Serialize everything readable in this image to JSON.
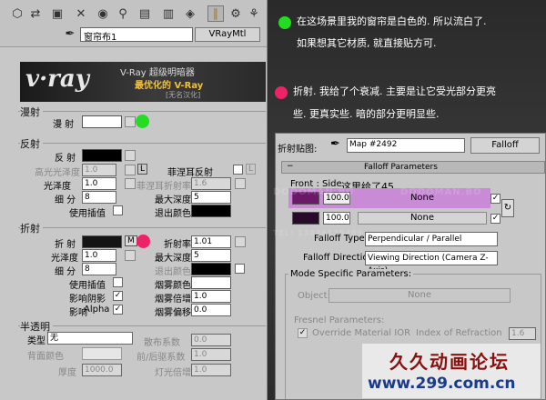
{
  "material_editor": {
    "toolbar_icons": [
      "get-material-icon",
      "put-material-icon",
      "assign-material-icon",
      "reset-icon",
      "make-copy-icon",
      "make-unique-icon",
      "put-library-icon",
      "material-id-icon",
      "show-map-icon",
      "show-end-icon",
      "go-parent-icon",
      "go-sibling-icon"
    ],
    "material_name": "窗帘布1",
    "material_type": "VRayMtl",
    "banner": {
      "logo": "v·ray",
      "line1": "V-Ray 超级明暗器",
      "line2": "最优化的 V-Ray",
      "line3": "[无名汉化]"
    },
    "diffuse": {
      "title": "漫射",
      "label": "漫 射",
      "color": "#ffffff"
    },
    "reflection": {
      "title": "反射",
      "reflect_label": "反 射",
      "reflect_color": "#000000",
      "hilight_gloss_label": "高光光泽度",
      "hilight_gloss_value": "1.0",
      "lock_label": "L",
      "fresnel_label": "菲涅耳反射",
      "gloss_label": "光泽度",
      "gloss_value": "1.0",
      "fresnel_ior_label": "菲涅耳折射率",
      "fresnel_ior_value": "1.6",
      "fresnel_lock": "L",
      "subdivs_label": "细 分",
      "subdivs_value": "8",
      "max_depth_label": "最大深度",
      "max_depth_value": "5",
      "interp_label": "使用插值",
      "exit_color_label": "退出颜色",
      "exit_color": "#000000"
    },
    "refraction": {
      "title": "折射",
      "refract_label": "折 射",
      "refract_color": "#141414",
      "m_label": "M",
      "ior_label": "折射率",
      "ior_value": "1.01",
      "gloss_label": "光泽度",
      "gloss_value": "1.0",
      "max_depth_label": "最大深度",
      "max_depth_value": "5",
      "subdivs_label": "细 分",
      "subdivs_value": "8",
      "exit_color_label": "退出颜色",
      "interp_label": "使用插值",
      "fog_color_label": "烟雾颜色",
      "fog_color": "#ffffff",
      "affect_shadows_label": "影响阴影",
      "fog_mult_label": "烟雾倍增",
      "fog_mult_value": "1.0",
      "affect_label": "影响",
      "affect_value": "Alpha",
      "fog_bias_label": "烟雾偏移",
      "fog_bias_value": "0.0"
    },
    "translucency": {
      "title": "半透明",
      "type_label": "类型",
      "type_value": "无",
      "scatter_label": "散布系数",
      "scatter_value": "0.0",
      "back_color_label": "背面颜色",
      "fwd_back_label": "前/后驱系数",
      "fwd_back_value": "1.0",
      "thickness_label": "厚度",
      "thickness_value": "1000.0",
      "light_mult_label": "灯光倍增",
      "light_mult_value": "1.0"
    }
  },
  "notes": [
    {
      "color": "#22dd22",
      "lines": [
        "在这场景里我的窗帘是白色的. 所以流白了.",
        "如果想其它材质, 就直接贴方可."
      ]
    },
    {
      "color": "#ee2266",
      "lines": [
        "折射. 我给了个衰减. 主要是让它受光部分更亮",
        "些. 更真实些. 暗的部分更明显些."
      ]
    }
  ],
  "falloff": {
    "map_label": "折射贴图:",
    "map_name": "Map #2492",
    "map_type": "Falloff",
    "rollout_title": "Falloff Parameters",
    "front_side_label": "Front : Side",
    "annotation": "这里给了45.",
    "slot1": {
      "value": "100.0",
      "map": "None",
      "color": "#6a1a66",
      "highlight": "#c98ad6"
    },
    "slot2": {
      "value": "100.0",
      "map": "None",
      "color": "#2a0a2a"
    },
    "type_label": "Falloff Type:",
    "type_value": "Perpendicular / Parallel",
    "direction_label": "Falloff Direction:",
    "direction_value": "Viewing Direction (Camera Z-Axis)",
    "mode_title": "Mode Specific Parameters:",
    "object_label": "Object:",
    "object_value": "None",
    "fresnel_title": "Fresnel Parameters:",
    "override_label": "Override Material IOR",
    "index_label": "Index of Refraction",
    "index_value": "1.6"
  },
  "watermarks": [
    "DODOMAN.BO",
    "TEL: 13824139489",
    "DODOMAN.BO"
  ],
  "forum_logo": {
    "title": "久久动画论坛",
    "site": "www.299.com.cn"
  }
}
